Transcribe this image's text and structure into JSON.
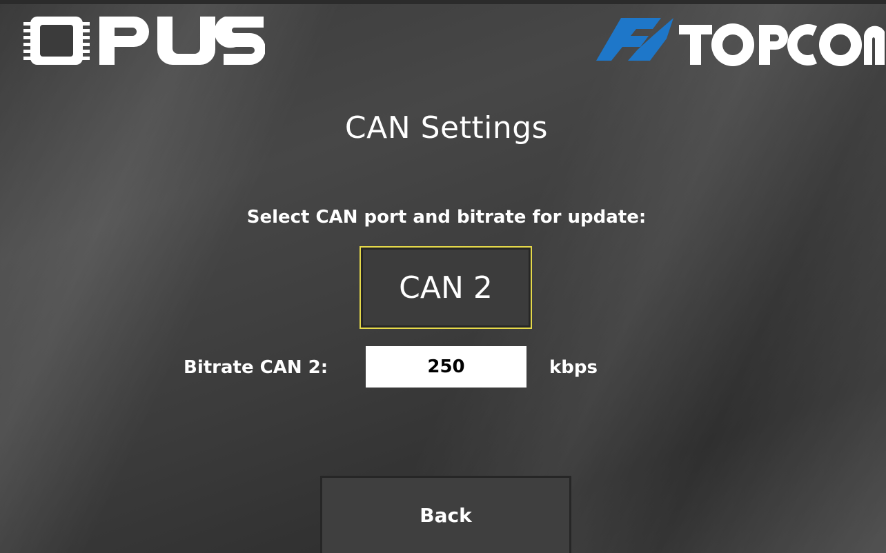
{
  "brand": {
    "left_logo": "OPUS",
    "right_logo": "TOPCON",
    "topcon_color": "#1e77c9"
  },
  "page": {
    "title": "CAN Settings",
    "instruction": "Select CAN port and bitrate for update:"
  },
  "can_port": {
    "selected_label": "CAN 2",
    "highlight_color": "#e5d94a"
  },
  "bitrate": {
    "label": "Bitrate CAN 2:",
    "value": "250",
    "unit": "kbps"
  },
  "actions": {
    "back_label": "Back"
  }
}
